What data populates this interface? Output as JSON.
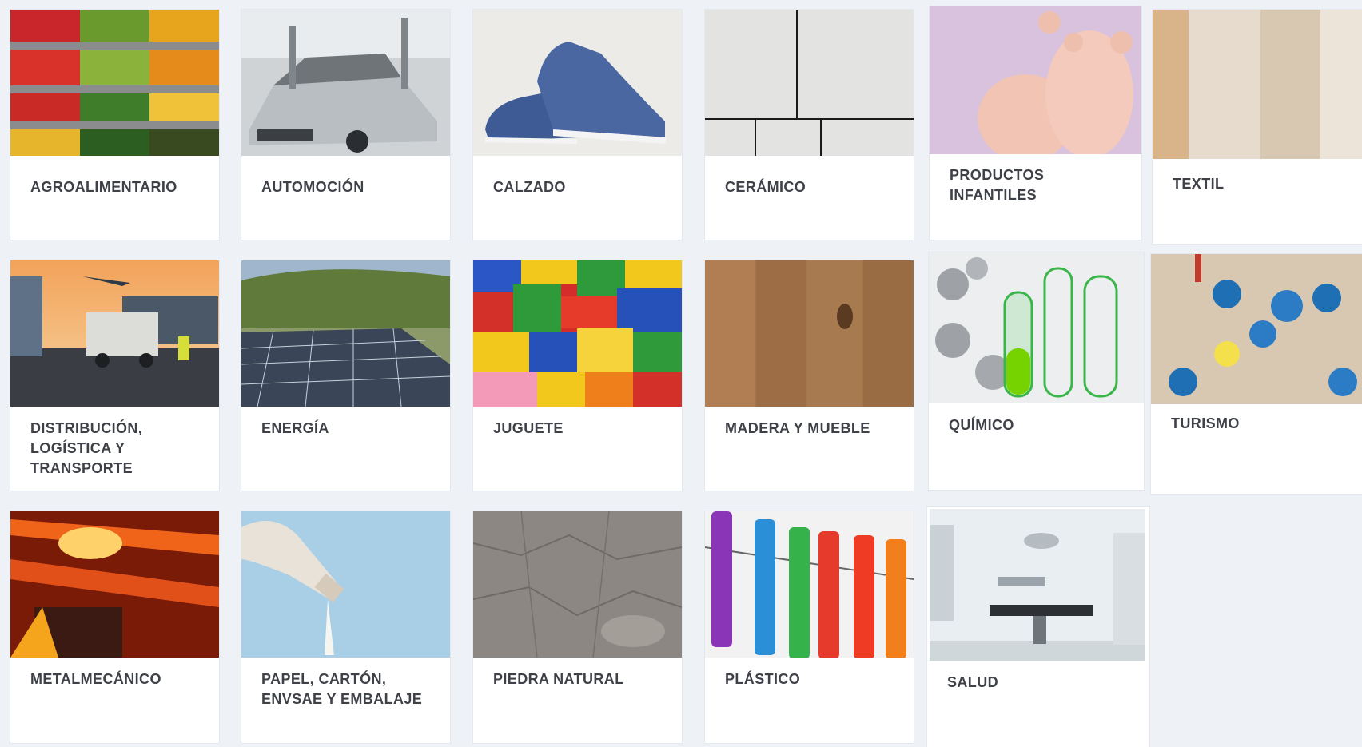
{
  "sectors": [
    {
      "label": "AGROALIMENTARIO",
      "image": "vegetable-market-photo"
    },
    {
      "label": "AUTOMOCIÓN",
      "image": "car-assembly-photo"
    },
    {
      "label": "CALZADO",
      "image": "blue-sneakers-photo"
    },
    {
      "label": "CERÁMICO",
      "image": "ceramic-tiles-photo"
    },
    {
      "label": "PRODUCTOS INFANTILES",
      "image": "baby-feet-photo"
    },
    {
      "label": "TEXTIL",
      "image": "knit-fabric-photo"
    },
    {
      "label": "DISTRIBUCIÓN, LOGÍSTICA Y TRANSPORTE",
      "image": "logistics-truck-photo"
    },
    {
      "label": "ENERGÍA",
      "image": "solar-panels-photo"
    },
    {
      "label": "JUGUETE",
      "image": "toy-bricks-photo"
    },
    {
      "label": "MADERA Y MUEBLE",
      "image": "wood-planks-photo"
    },
    {
      "label": "QUÍMICO",
      "image": "test-tubes-photo"
    },
    {
      "label": "TURISMO",
      "image": "beach-umbrellas-photo"
    },
    {
      "label": "METALMECÁNICO",
      "image": "hot-steel-photo"
    },
    {
      "label": "PAPEL, CARTÓN, ENVSAE Y EMBALAJE",
      "image": "bottle-pouring-photo"
    },
    {
      "label": "PIEDRA NATURAL",
      "image": "stone-texture-photo"
    },
    {
      "label": "PLÁSTICO",
      "image": "clothespins-photo"
    },
    {
      "label": "SALUD",
      "image": "operating-room-photo"
    }
  ]
}
